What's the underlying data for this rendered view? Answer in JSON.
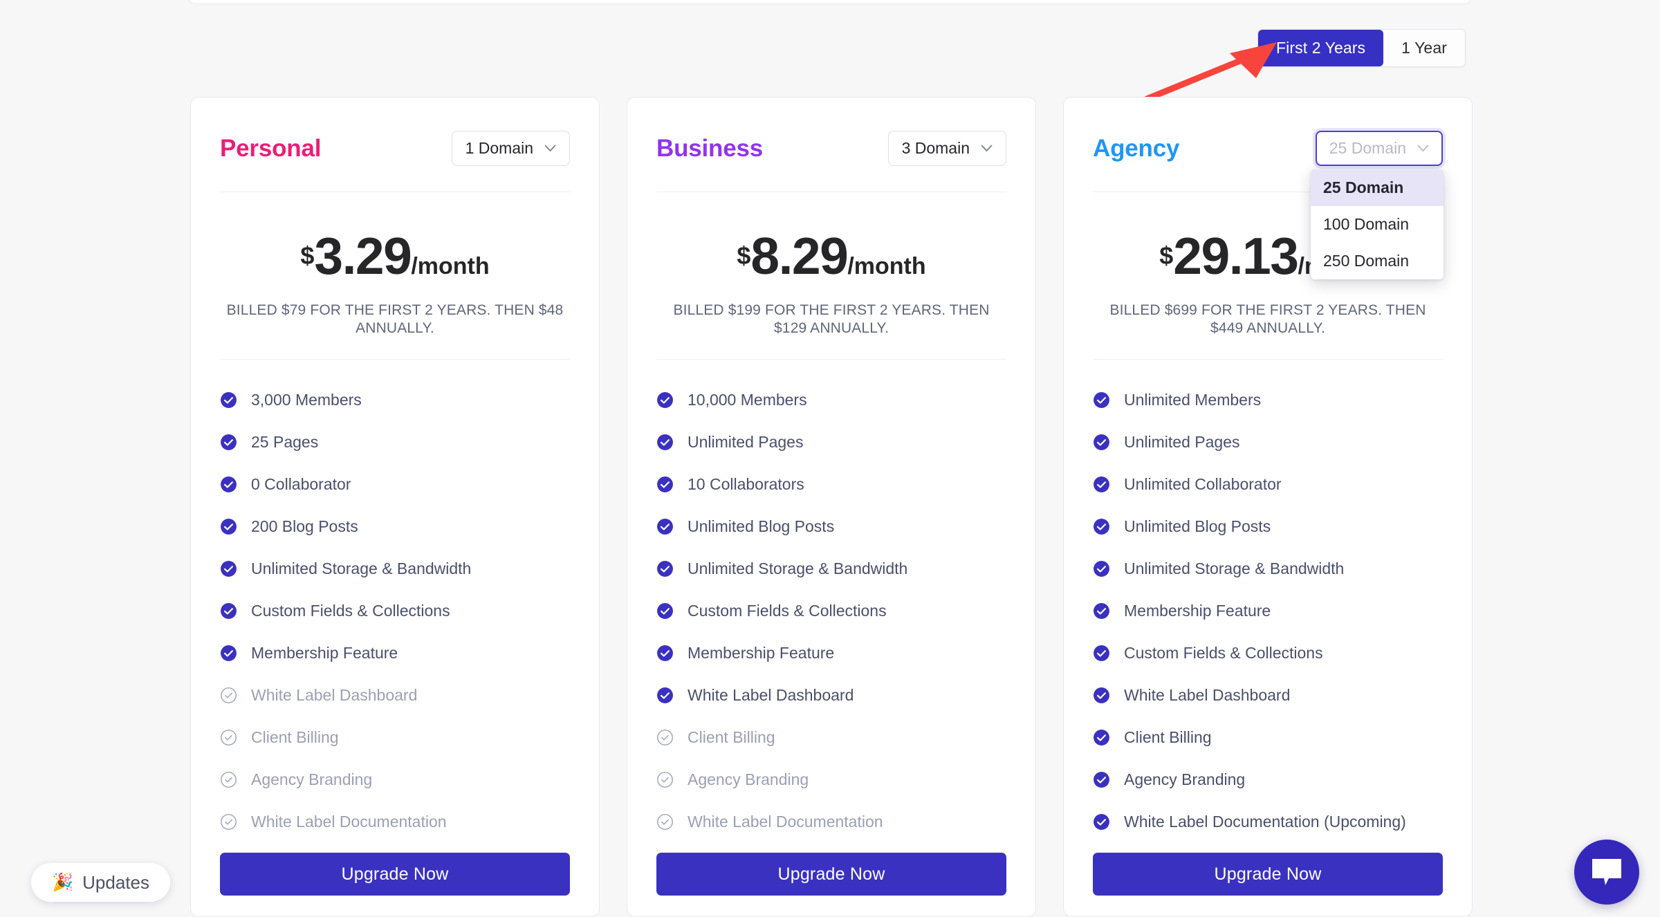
{
  "billing_toggle": {
    "options": [
      {
        "label": "First 2 Years",
        "active": true
      },
      {
        "label": "1 Year",
        "active": false
      }
    ]
  },
  "annotation": {
    "type": "arrow",
    "color": "#f8443c",
    "points_to": "First 2 Years"
  },
  "colors": {
    "page_background": "#f7f7f8",
    "card_background": "#ffffff",
    "accent_indigo": "#3b31c0",
    "personal_title": "#e91e78",
    "business_title": "#9333ea",
    "agency_title": "#2196f3",
    "check_on": "#3b31c0",
    "check_off": "#a5a9bd",
    "feature_text": "#4a4f6b",
    "feature_text_off": "#9b9fb4",
    "select_focus_border": "#4b3fd6",
    "select_option_selected_bg": "#e7e4f7"
  },
  "plans": [
    {
      "name": "Personal",
      "name_color": "#e91e78",
      "domain_select": {
        "value": "1 Domain",
        "open": false,
        "icon": "chevron-down-icon",
        "options": [
          "1 Domain"
        ]
      },
      "currency": "$",
      "amount": "3.29",
      "period": "/month",
      "billed_note": "BILLED $79 FOR THE FIRST 2 YEARS. THEN $48 ANNUALLY.",
      "billed_total": "$79",
      "renewal_price": "$48",
      "features": [
        {
          "label": "3,000 Members",
          "enabled": true
        },
        {
          "label": "25 Pages",
          "enabled": true
        },
        {
          "label": "0 Collaborator",
          "enabled": true
        },
        {
          "label": "200 Blog Posts",
          "enabled": true
        },
        {
          "label": "Unlimited Storage & Bandwidth",
          "enabled": true
        },
        {
          "label": "Custom Fields & Collections",
          "enabled": true
        },
        {
          "label": "Membership Feature",
          "enabled": true
        },
        {
          "label": "White Label Dashboard",
          "enabled": false
        },
        {
          "label": "Client Billing",
          "enabled": false
        },
        {
          "label": "Agency Branding",
          "enabled": false
        },
        {
          "label": "White Label Documentation",
          "enabled": false
        }
      ],
      "cta": "Upgrade Now"
    },
    {
      "name": "Business",
      "name_color": "#9333ea",
      "domain_select": {
        "value": "3 Domain",
        "open": false,
        "icon": "chevron-down-icon",
        "options": [
          "3 Domain"
        ]
      },
      "currency": "$",
      "amount": "8.29",
      "period": "/month",
      "billed_note": "BILLED $199 FOR THE FIRST 2 YEARS. THEN $129 ANNUALLY.",
      "billed_total": "$199",
      "renewal_price": "$129",
      "features": [
        {
          "label": "10,000 Members",
          "enabled": true
        },
        {
          "label": "Unlimited Pages",
          "enabled": true
        },
        {
          "label": "10 Collaborators",
          "enabled": true
        },
        {
          "label": "Unlimited Blog Posts",
          "enabled": true
        },
        {
          "label": "Unlimited Storage & Bandwidth",
          "enabled": true
        },
        {
          "label": "Custom Fields & Collections",
          "enabled": true
        },
        {
          "label": "Membership Feature",
          "enabled": true
        },
        {
          "label": "White Label Dashboard",
          "enabled": true
        },
        {
          "label": "Client Billing",
          "enabled": false
        },
        {
          "label": "Agency Branding",
          "enabled": false
        },
        {
          "label": "White Label Documentation",
          "enabled": false
        }
      ],
      "cta": "Upgrade Now"
    },
    {
      "name": "Agency",
      "name_color": "#2196f3",
      "domain_select": {
        "value": "25 Domain",
        "open": true,
        "icon": "chevron-down-icon",
        "options": [
          "25 Domain",
          "100 Domain",
          "250 Domain"
        ],
        "selected_option": "25 Domain"
      },
      "currency": "$",
      "amount": "29.13",
      "period": "/month",
      "billed_note": "BILLED $699 FOR THE FIRST 2 YEARS. THEN $449 ANNUALLY.",
      "billed_total": "$699",
      "renewal_price": "$449",
      "features": [
        {
          "label": "Unlimited Members",
          "enabled": true
        },
        {
          "label": "Unlimited Pages",
          "enabled": true
        },
        {
          "label": "Unlimited Collaborator",
          "enabled": true
        },
        {
          "label": "Unlimited Blog Posts",
          "enabled": true
        },
        {
          "label": "Unlimited Storage & Bandwidth",
          "enabled": true
        },
        {
          "label": "Membership Feature",
          "enabled": true
        },
        {
          "label": "Custom Fields & Collections",
          "enabled": true
        },
        {
          "label": "White Label Dashboard",
          "enabled": true
        },
        {
          "label": "Client Billing",
          "enabled": true
        },
        {
          "label": "Agency Branding",
          "enabled": true
        },
        {
          "label": "White Label Documentation (Upcoming)",
          "enabled": true
        }
      ],
      "cta": "Upgrade Now"
    }
  ],
  "updates_widget": {
    "emoji": "🎉",
    "label": "Updates",
    "icon": "party-popper-icon"
  },
  "chat_widget": {
    "icon": "chat-bubble-icon"
  }
}
